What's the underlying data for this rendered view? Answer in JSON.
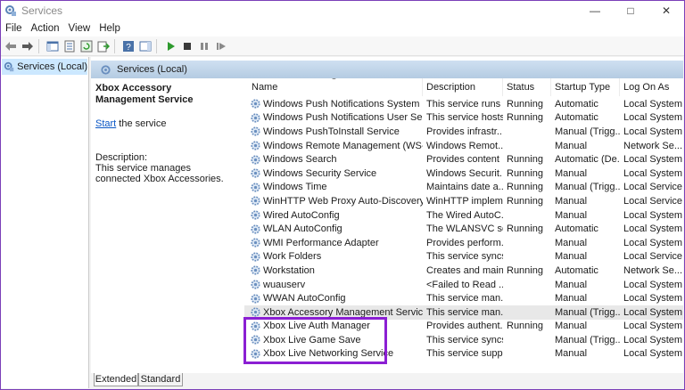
{
  "window": {
    "title": "Services"
  },
  "menu": [
    "File",
    "Action",
    "View",
    "Help"
  ],
  "tree": {
    "root_label": "Services (Local)"
  },
  "pane": {
    "header_label": "Services (Local)"
  },
  "details": {
    "service_title": "Xbox Accessory Management Service",
    "start_link": "Start",
    "start_suffix": " the service",
    "description_label": "Description:",
    "description_text": "This service manages connected Xbox Accessories."
  },
  "columns": [
    "Name",
    "Description",
    "Status",
    "Startup Type",
    "Log On As"
  ],
  "services": [
    {
      "name": "Windows Push Notifications System Ser...",
      "description": "This service runs ...",
      "status": "Running",
      "startup": "Automatic",
      "logon": "Local System"
    },
    {
      "name": "Windows Push Notifications User Servic...",
      "description": "This service hosts...",
      "status": "Running",
      "startup": "Automatic",
      "logon": "Local System"
    },
    {
      "name": "Windows PushToInstall Service",
      "description": "Provides infrastr...",
      "status": "",
      "startup": "Manual (Trigg...",
      "logon": "Local System"
    },
    {
      "name": "Windows Remote Management (WS-M...",
      "description": "Windows Remot...",
      "status": "",
      "startup": "Manual",
      "logon": "Network Se..."
    },
    {
      "name": "Windows Search",
      "description": "Provides content ...",
      "status": "Running",
      "startup": "Automatic (De...",
      "logon": "Local System"
    },
    {
      "name": "Windows Security Service",
      "description": "Windows Securit...",
      "status": "Running",
      "startup": "Manual",
      "logon": "Local System"
    },
    {
      "name": "Windows Time",
      "description": "Maintains date a...",
      "status": "Running",
      "startup": "Manual (Trigg...",
      "logon": "Local Service"
    },
    {
      "name": "WinHTTP Web Proxy Auto-Discovery Se...",
      "description": "WinHTTP implem...",
      "status": "Running",
      "startup": "Manual",
      "logon": "Local Service"
    },
    {
      "name": "Wired AutoConfig",
      "description": "The Wired AutoC...",
      "status": "",
      "startup": "Manual",
      "logon": "Local System"
    },
    {
      "name": "WLAN AutoConfig",
      "description": "The WLANSVC se...",
      "status": "Running",
      "startup": "Automatic",
      "logon": "Local System"
    },
    {
      "name": "WMI Performance Adapter",
      "description": "Provides perform...",
      "status": "",
      "startup": "Manual",
      "logon": "Local System"
    },
    {
      "name": "Work Folders",
      "description": "This service syncs...",
      "status": "",
      "startup": "Manual",
      "logon": "Local Service"
    },
    {
      "name": "Workstation",
      "description": "Creates and main...",
      "status": "Running",
      "startup": "Automatic",
      "logon": "Network Se..."
    },
    {
      "name": "wuauserv",
      "description": "<Failed to Read ...",
      "status": "",
      "startup": "Manual",
      "logon": "Local System"
    },
    {
      "name": "WWAN AutoConfig",
      "description": "This service man...",
      "status": "",
      "startup": "Manual",
      "logon": "Local System"
    },
    {
      "name": "Xbox Accessory Management Service",
      "description": "This service man...",
      "status": "",
      "startup": "Manual (Trigg...",
      "logon": "Local System",
      "selected": true
    },
    {
      "name": "Xbox Live Auth Manager",
      "description": "Provides authent...",
      "status": "Running",
      "startup": "Manual",
      "logon": "Local System"
    },
    {
      "name": "Xbox Live Game Save",
      "description": "This service syncs...",
      "status": "",
      "startup": "Manual (Trigg...",
      "logon": "Local System"
    },
    {
      "name": "Xbox Live Networking Service",
      "description": "This service supp...",
      "status": "",
      "startup": "Manual",
      "logon": "Local System"
    }
  ],
  "tabs": [
    "Extended",
    "Standard"
  ],
  "colors": {
    "highlight_border": "#8b1fd3",
    "link": "#0b57c5",
    "header_gradient": "#b4cbe2"
  }
}
